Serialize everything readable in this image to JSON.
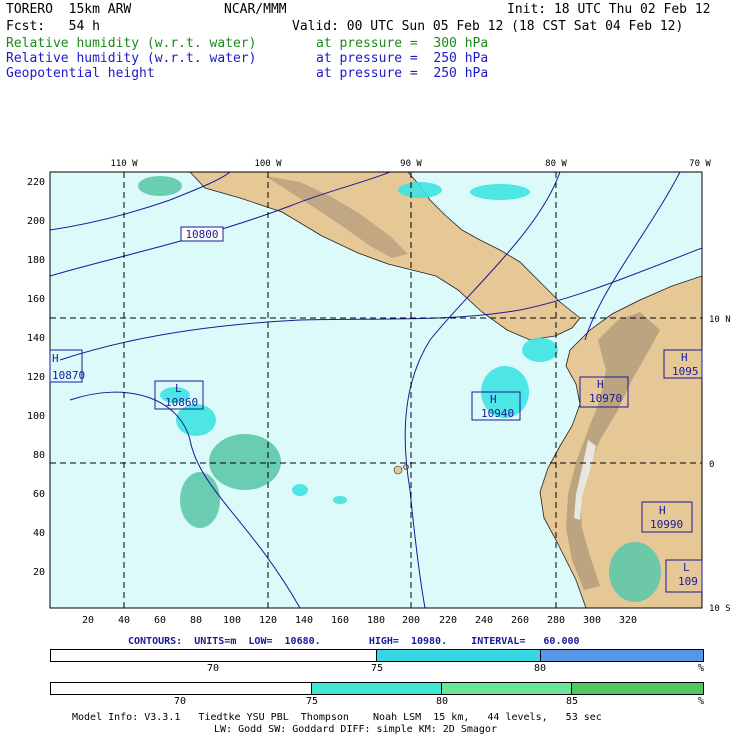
{
  "header": {
    "model": "TORERO  15km ARW",
    "org": "NCAR/MMM",
    "init": "Init: 18 UTC Thu 02 Feb 12",
    "fcst": "Fcst:   54 h",
    "valid": "Valid: 00 UTC Sun 05 Feb 12 (18 CST Sat 04 Feb 12)"
  },
  "fields": [
    {
      "name": "Relative humidity (w.r.t. water)",
      "level": "at pressure =  300 hPa",
      "color": "#1a8a1a"
    },
    {
      "name": "Relative humidity (w.r.t. water)",
      "level": "at pressure =  250 hPa",
      "color": "#1a1acc"
    },
    {
      "name": "Geopotential height",
      "level": "at pressure =  250 hPa",
      "color": "#1a1acc"
    }
  ],
  "map": {
    "top_labels": [
      "110 W",
      "100 W",
      "90 W",
      "80 W",
      "70 W"
    ],
    "right_labels": [
      "10 N",
      "0",
      "10 S"
    ],
    "y_ticks": [
      "220",
      "200",
      "180",
      "160",
      "140",
      "120",
      "100",
      "80",
      "60",
      "40",
      "20"
    ],
    "x_ticks": [
      "20",
      "40",
      "60",
      "80",
      "100",
      "120",
      "140",
      "160",
      "180",
      "200",
      "220",
      "240",
      "260",
      "280",
      "300",
      "320"
    ],
    "contour_label": "10800",
    "highs_lows": [
      {
        "kind": "H",
        "value": "10870"
      },
      {
        "kind": "L",
        "value": "10860"
      },
      {
        "kind": "H",
        "value": "10940"
      },
      {
        "kind": "H",
        "value": "10970"
      },
      {
        "kind": "H",
        "value": "1095"
      },
      {
        "kind": "H",
        "value": "10990"
      },
      {
        "kind": "L",
        "value": "109"
      }
    ],
    "colors": {
      "ocean": "#dcfafa",
      "land": "#e6c796",
      "mountain": "#b49d7c",
      "high_peak": "#ececec",
      "contour": "#1a1a99",
      "rh_300": "#5ec8a8",
      "rh_250": "#3fe3e3"
    }
  },
  "contour_info": "CONTOURS:  UNITS=m  LOW=  10680.        HIGH=  10980.    INTERVAL=   60.000",
  "scale1": {
    "ticks": [
      "70",
      "75",
      "80"
    ],
    "unit": "%",
    "colors": [
      "#ffffff",
      "#36d6e3",
      "#5a96e6"
    ]
  },
  "scale2": {
    "ticks": [
      "70",
      "75",
      "80",
      "85"
    ],
    "unit": "%",
    "colors": [
      "#ffffff",
      "#3fe8d2",
      "#6be598",
      "#4fc95d"
    ]
  },
  "footer": {
    "line1": "Model Info: V3.3.1   Tiedtke YSU PBL  Thompson    Noah LSM  15 km,   44 levels,   53 sec",
    "line2": "LW: Godd SW: Goddard DIFF: simple KM: 2D Smagor"
  }
}
